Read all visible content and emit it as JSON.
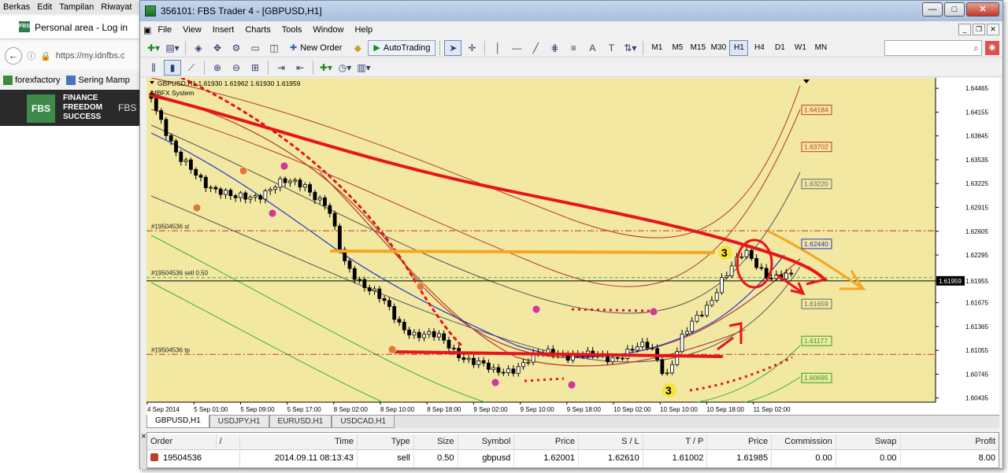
{
  "browser": {
    "menu": [
      "Berkas",
      "Edit",
      "Tampilan",
      "Riwayat"
    ],
    "tab_title": "Personal area - Log in",
    "url": "https://my.idnfbs.c",
    "bookmarks": [
      "forexfactory",
      "Sering Mamp"
    ],
    "fbs_logo": "FBS",
    "fbs_slogan": [
      "FINANCE",
      "FREEDOM",
      "SUCCESS"
    ],
    "fbs_logo2": "FBS"
  },
  "window": {
    "title": "356101: FBS Trader 4 - [GBPUSD,H1]",
    "menu": [
      "File",
      "View",
      "Insert",
      "Charts",
      "Tools",
      "Window",
      "Help"
    ]
  },
  "toolbar": {
    "new_order": "New Order",
    "autotrading": "AutoTrading",
    "timeframes": [
      "M1",
      "M5",
      "M15",
      "M30",
      "H1",
      "H4",
      "D1",
      "W1",
      "MN"
    ],
    "active_timeframe": "H1",
    "search_placeholder": ""
  },
  "chart": {
    "header": "GBPUSD,H1  1.61930 1.61962 1.61930 1.61959",
    "indicator_label": "MBFX System",
    "price_labels": [
      "1.64465",
      "1.64155",
      "1.63845",
      "1.63535",
      "1.63225",
      "1.62915",
      "1.62605",
      "1.62295",
      "1.61955",
      "1.61675",
      "1.61365",
      "1.61055",
      "1.60745",
      "1.60435"
    ],
    "current_price": "1.61959",
    "time_labels": [
      "4 Sep 2014",
      "5 Sep 01:00",
      "5 Sep 09:00",
      "5 Sep 17:00",
      "8 Sep 02:00",
      "8 Sep 10:00",
      "8 Sep 18:00",
      "9 Sep 02:00",
      "9 Sep 10:00",
      "9 Sep 18:00",
      "10 Sep 02:00",
      "10 Sep 10:00",
      "10 Sep 18:00",
      "11 Sep 02:00"
    ],
    "order_lines": {
      "sl": "#19504536 sl",
      "sell": "#19504536 sell 0.50",
      "tp": "#19504536 tp"
    },
    "level_boxes": [
      "1.64184",
      "1.63702",
      "1.63220",
      "1.62440",
      "1.61659",
      "1.61177",
      "1.60695"
    ],
    "wave_labels": [
      "3",
      "3"
    ],
    "colors": {
      "background": "#f2e8a2",
      "bull": "#ffffff",
      "bear": "#000000",
      "annotation_red": "#e8131b",
      "annotation_orange": "#f5a623",
      "ma_blue": "#2233cc"
    }
  },
  "chart_tabs": [
    "GBPUSD,H1",
    "USDJPY,H1",
    "EURUSD,H1",
    "USDCAD,H1"
  ],
  "active_chart_tab": "GBPUSD,H1",
  "terminal": {
    "columns": [
      "Order",
      "/",
      "Time",
      "Type",
      "Size",
      "Symbol",
      "Price",
      "S / L",
      "T / P",
      "Price",
      "Commission",
      "Swap",
      "Profit"
    ],
    "rows": [
      {
        "order": "19504536",
        "time": "2014.09.11 08:13:43",
        "type": "sell",
        "size": "0.50",
        "symbol": "gbpusd",
        "price": "1.62001",
        "sl": "1.62610",
        "tp": "1.61002",
        "cur_price": "1.61985",
        "commission": "0.00",
        "swap": "0.00",
        "profit": "8.00"
      }
    ]
  }
}
